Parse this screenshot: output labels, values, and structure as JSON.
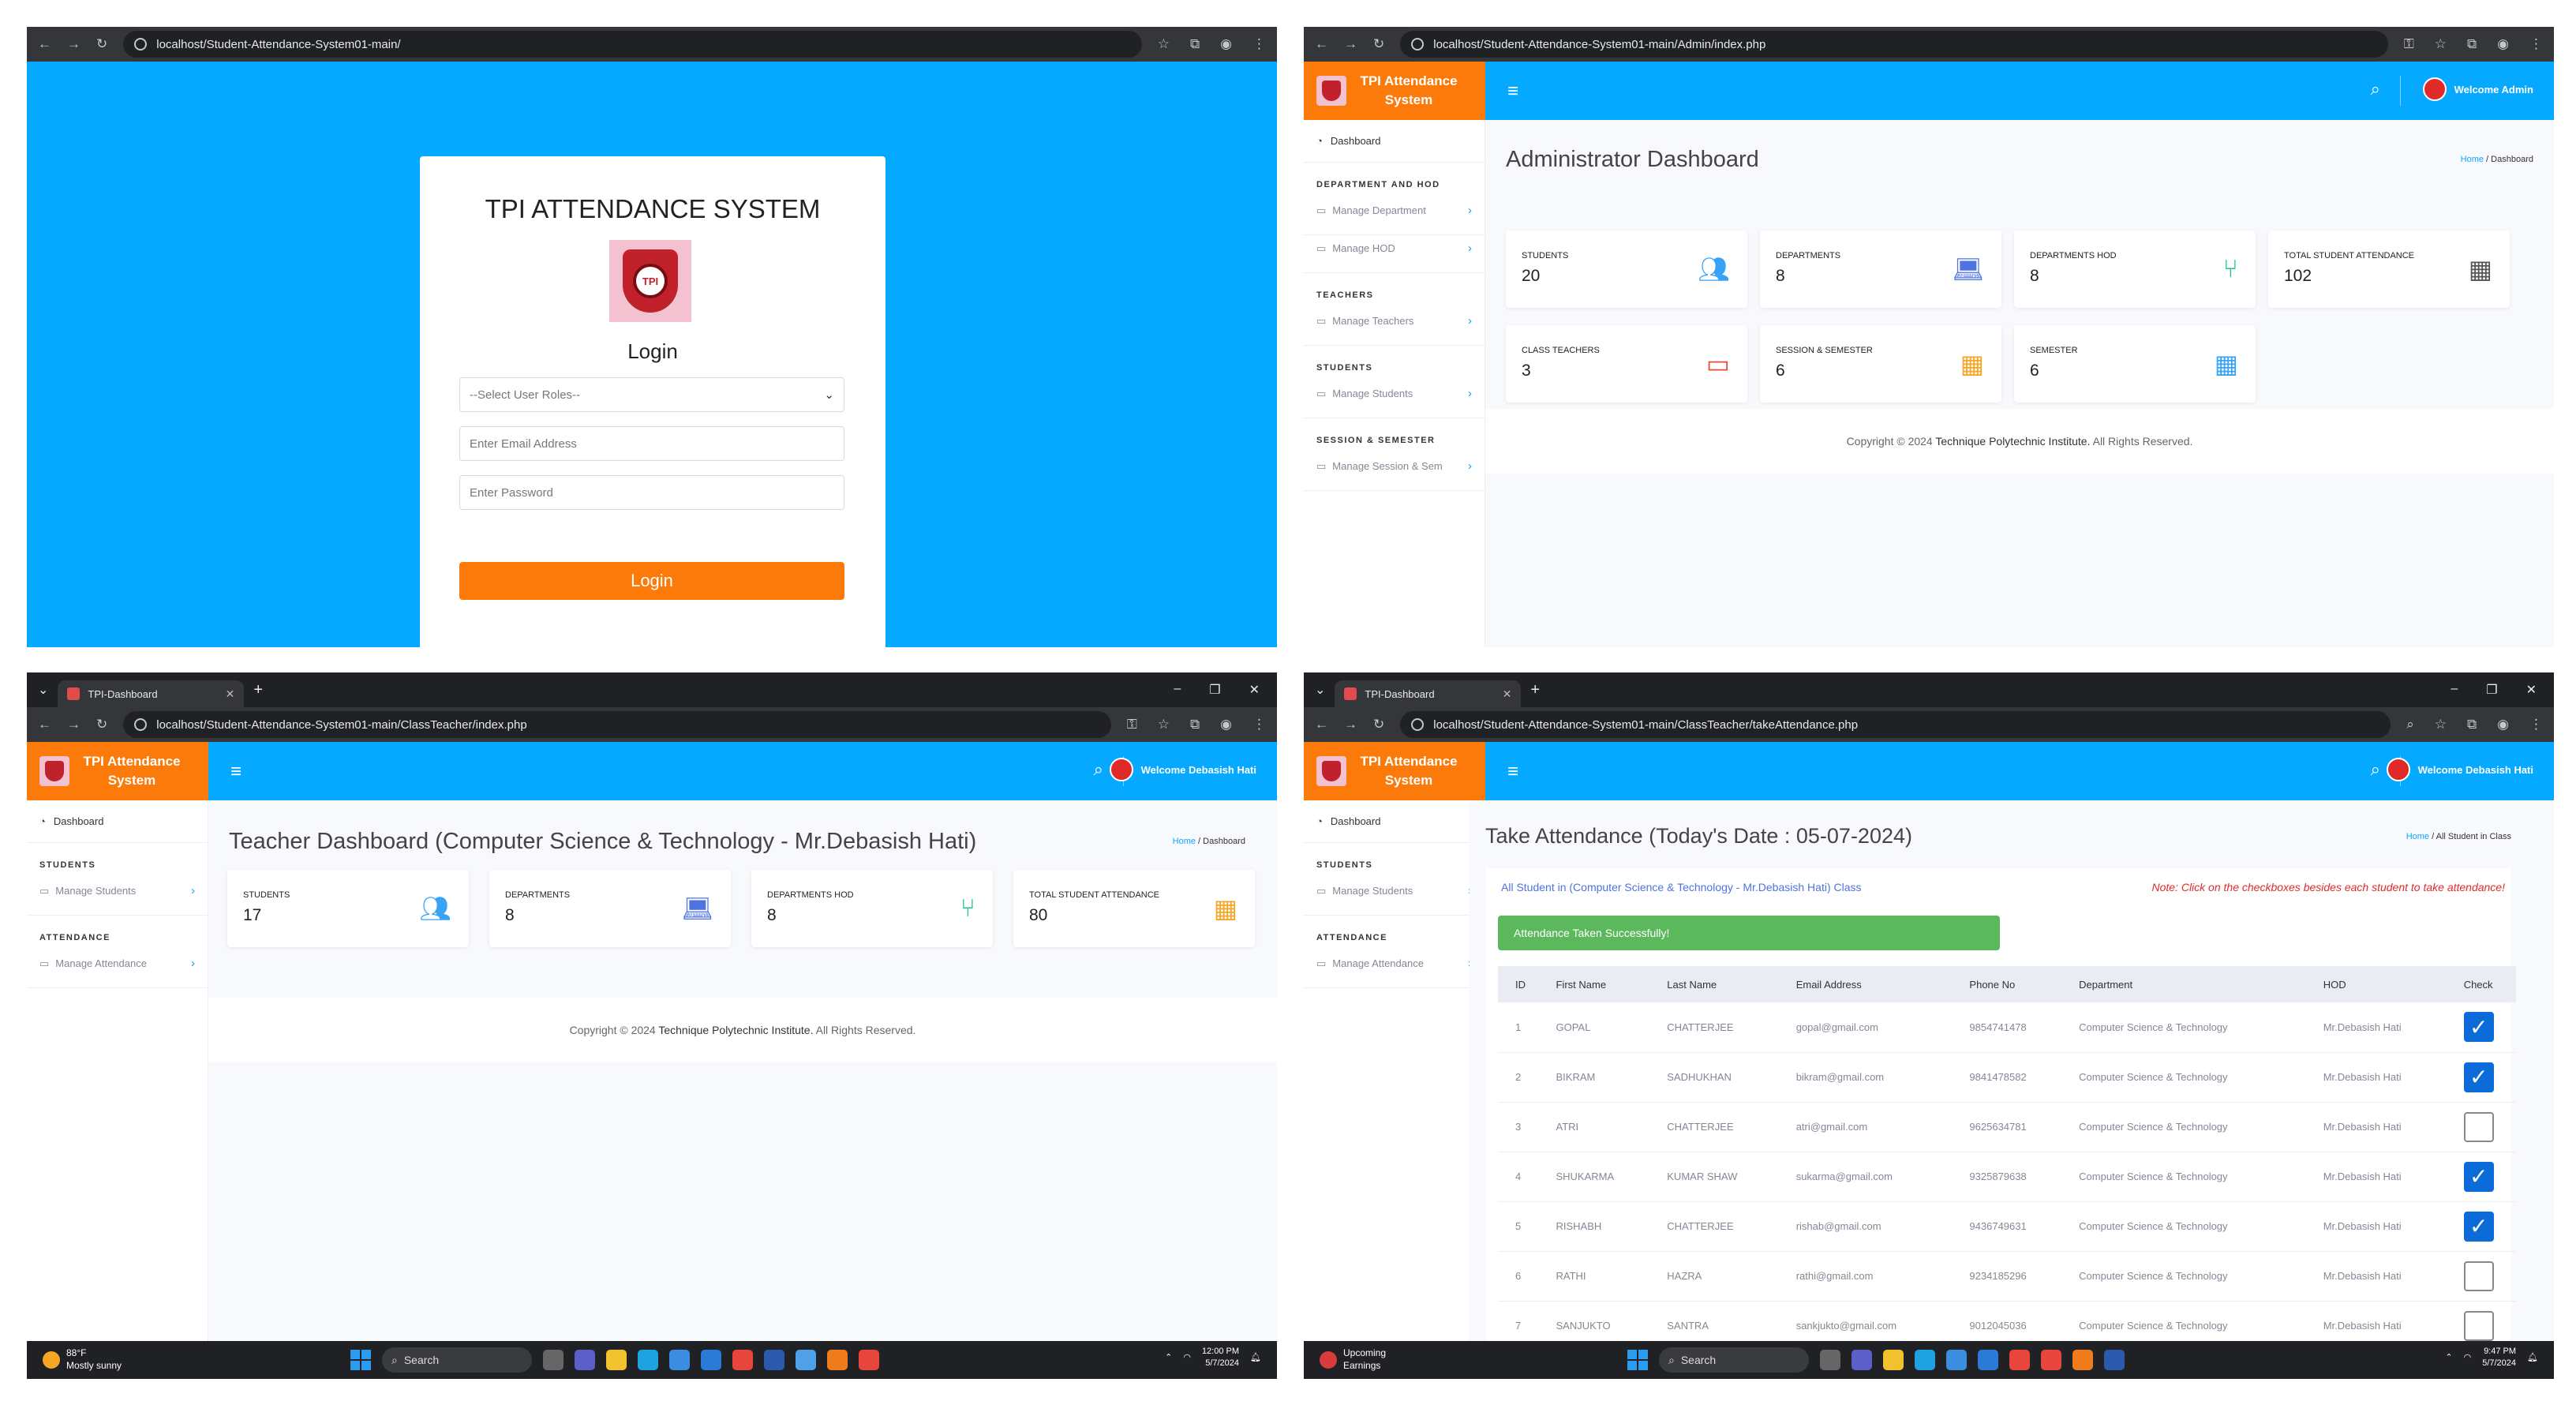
{
  "login": {
    "url": "localhost/Student-Attendance-System01-main/",
    "title": "TPI ATTENDANCE SYSTEM",
    "logo_text": "TPI",
    "subtitle": "Login",
    "role_placeholder": "--Select User Roles--",
    "email_placeholder": "Enter Email Address",
    "password_placeholder": "Enter Password",
    "button": "Login"
  },
  "admin": {
    "url": "localhost/Student-Attendance-System01-main/Admin/index.php",
    "brand": "TPI Attendance System",
    "welcome": "Welcome Admin",
    "page_title": "Administrator Dashboard",
    "breadcrumb": {
      "home": "Home",
      "sep": "/",
      "current": "Dashboard"
    },
    "sidebar": {
      "dashboard": "Dashboard",
      "sections": [
        {
          "head": "DEPARTMENT AND HOD",
          "items": [
            "Manage Department",
            "Manage HOD"
          ]
        },
        {
          "head": "TEACHERS",
          "items": [
            "Manage Teachers"
          ]
        },
        {
          "head": "STUDENTS",
          "items": [
            "Manage Students"
          ]
        },
        {
          "head": "SESSION & SEMESTER",
          "items": [
            "Manage Session & Sem"
          ]
        }
      ]
    },
    "cards": [
      {
        "label": "STUDENTS",
        "value": "20",
        "icon": "users-icon",
        "color": "#36a3f7"
      },
      {
        "label": "DEPARTMENTS",
        "value": "8",
        "icon": "laptop-icon",
        "color": "#4e73df"
      },
      {
        "label": "DEPARTMENTS HOD",
        "value": "8",
        "icon": "branch-icon",
        "color": "#1cc88a"
      },
      {
        "label": "TOTAL STUDENT ATTENDANCE",
        "value": "102",
        "icon": "calendar-icon",
        "color": "#555555"
      },
      {
        "label": "CLASS TEACHERS",
        "value": "3",
        "icon": "chalkboard-icon",
        "color": "#e74a3b"
      },
      {
        "label": "SESSION & SEMESTER",
        "value": "6",
        "icon": "calendar-icon",
        "color": "#f6a623"
      },
      {
        "label": "SEMESTER",
        "value": "6",
        "icon": "grid-icon",
        "color": "#36a3f7"
      }
    ],
    "footer": {
      "prefix": "Copyright © 2024 ",
      "org": "Technique Polytechnic Institute.",
      "suffix": " All Rights Reserved."
    }
  },
  "teacher": {
    "tab": "TPI-Dashboard",
    "url": "localhost/Student-Attendance-System01-main/ClassTeacher/index.php",
    "brand": "TPI Attendance System",
    "welcome": "Welcome Debasish Hati",
    "page_title": "Teacher Dashboard (Computer Science & Technology - Mr.Debasish Hati)",
    "breadcrumb": {
      "home": "Home",
      "sep": "/",
      "current": "Dashboard"
    },
    "sidebar": {
      "dashboard": "Dashboard",
      "sections": [
        {
          "head": "STUDENTS",
          "items": [
            "Manage Students"
          ]
        },
        {
          "head": "ATTENDANCE",
          "items": [
            "Manage Attendance"
          ]
        }
      ]
    },
    "cards": [
      {
        "label": "STUDENTS",
        "value": "17",
        "icon": "users-icon",
        "color": "#36a3f7"
      },
      {
        "label": "DEPARTMENTS",
        "value": "8",
        "icon": "laptop-icon",
        "color": "#4e73df"
      },
      {
        "label": "DEPARTMENTS HOD",
        "value": "8",
        "icon": "branch-icon",
        "color": "#1cc88a"
      },
      {
        "label": "TOTAL STUDENT ATTENDANCE",
        "value": "80",
        "icon": "calendar-icon",
        "color": "#f6a623"
      }
    ],
    "footer": {
      "prefix": "Copyright © 2024 ",
      "org": "Technique Polytechnic Institute.",
      "suffix": " All Rights Reserved."
    },
    "taskbar": {
      "temp": "88°F",
      "weather": "Mostly sunny",
      "search": "Search",
      "time": "12:00 PM",
      "date": "5/7/2024"
    }
  },
  "attendance": {
    "tab": "TPI-Dashboard",
    "url": "localhost/Student-Attendance-System01-main/ClassTeacher/takeAttendance.php",
    "brand": "TPI Attendance System",
    "welcome": "Welcome Debasish Hati",
    "page_title": "Take Attendance (Today's Date : 05-07-2024)",
    "breadcrumb": {
      "home": "Home",
      "sep": "/",
      "current": "All Student in Class"
    },
    "sidebar": {
      "dashboard": "Dashboard",
      "sections": [
        {
          "head": "STUDENTS",
          "items": [
            "Manage Students"
          ]
        },
        {
          "head": "ATTENDANCE",
          "items": [
            "Manage Attendance"
          ]
        }
      ]
    },
    "class_header": "All Student in (Computer Science & Technology - Mr.Debasish Hati) Class",
    "note": "Note: Click on the checkboxes besides each student to take attendance!",
    "alert": "Attendance Taken Successfully!",
    "columns": [
      "ID",
      "First Name",
      "Last Name",
      "Email Address",
      "Phone No",
      "Department",
      "HOD",
      "Check"
    ],
    "rows": [
      {
        "id": "1",
        "first": "GOPAL",
        "last": "CHATTERJEE",
        "email": "gopal@gmail.com",
        "phone": "9854741478",
        "dept": "Computer Science & Technology",
        "hod": "Mr.Debasish Hati",
        "checked": true
      },
      {
        "id": "2",
        "first": "BIKRAM",
        "last": "SADHUKHAN",
        "email": "bikram@gmail.com",
        "phone": "9841478582",
        "dept": "Computer Science & Technology",
        "hod": "Mr.Debasish Hati",
        "checked": true
      },
      {
        "id": "3",
        "first": "ATRI",
        "last": "CHATTERJEE",
        "email": "atri@gmail.com",
        "phone": "9625634781",
        "dept": "Computer Science & Technology",
        "hod": "Mr.Debasish Hati",
        "checked": false
      },
      {
        "id": "4",
        "first": "SHUKARMA",
        "last": "KUMAR SHAW",
        "email": "sukarma@gmail.com",
        "phone": "9325879638",
        "dept": "Computer Science & Technology",
        "hod": "Mr.Debasish Hati",
        "checked": true
      },
      {
        "id": "5",
        "first": "RISHABH",
        "last": "CHATTERJEE",
        "email": "rishab@gmail.com",
        "phone": "9436749631",
        "dept": "Computer Science & Technology",
        "hod": "Mr.Debasish Hati",
        "checked": true
      },
      {
        "id": "6",
        "first": "RATHI",
        "last": "HAZRA",
        "email": "rathi@gmail.com",
        "phone": "9234185296",
        "dept": "Computer Science & Technology",
        "hod": "Mr.Debasish Hati",
        "checked": false
      },
      {
        "id": "7",
        "first": "SANJUKTO",
        "last": "SANTRA",
        "email": "sankjukto@gmail.com",
        "phone": "9012045036",
        "dept": "Computer Science & Technology",
        "hod": "Mr.Debasish Hati",
        "checked": false
      }
    ],
    "taskbar": {
      "news": "Upcoming",
      "news_sub": "Earnings",
      "search": "Search",
      "time": "9:47 PM",
      "date": "5/7/2024"
    }
  }
}
